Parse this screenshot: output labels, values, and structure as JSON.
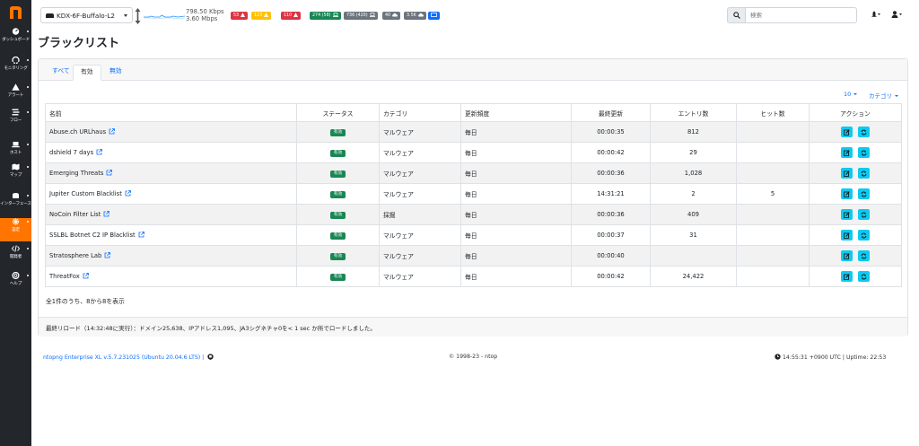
{
  "sidebar": {
    "items": [
      {
        "label": "ダッシュボード",
        "icon": "gauge-icon"
      },
      {
        "label": "モニタリング",
        "icon": "monitoring-icon"
      },
      {
        "label": "アラート",
        "icon": "warning-icon"
      },
      {
        "label": "フロー",
        "icon": "stream-icon"
      },
      {
        "label": "ホスト",
        "icon": "laptop-icon"
      },
      {
        "label": "マップ",
        "icon": "map-icon"
      },
      {
        "label": "インターフェース",
        "icon": "ethernet-icon"
      },
      {
        "label": "設定",
        "icon": "gear-icon"
      },
      {
        "label": "開発者",
        "icon": "code-icon"
      },
      {
        "label": "ヘルプ",
        "icon": "lifebuoy-icon"
      }
    ],
    "active_index": 7
  },
  "header": {
    "interface": "KDX-6F-Buffalo-L2",
    "speed_up": "798.50 Kbps",
    "speed_down": "3.60 Mbps",
    "badges": [
      {
        "text": "53",
        "color": "#dc3545"
      },
      {
        "text": "123",
        "color": "#ffc107"
      },
      {
        "text": "110",
        "color": "#dc3545"
      },
      {
        "text": "274 (58)",
        "color": "#198754"
      },
      {
        "text": "736 (420)",
        "color": "#6c757d"
      },
      {
        "text": "40",
        "color": "#6c757d"
      },
      {
        "text": "3.5K",
        "color": "#6c757d"
      },
      {
        "text": "",
        "color": "#0d6efd"
      }
    ],
    "search_placeholder": "検索"
  },
  "page": {
    "title": "ブラックリスト",
    "tabs": [
      "すべて",
      "有効",
      "無効"
    ],
    "active_tab": 1,
    "per_page": "10",
    "category_filter": "カテゴリ"
  },
  "table": {
    "columns": [
      "名前",
      "ステータス",
      "カテゴリ",
      "更新頻度",
      "最終更新",
      "エントリ数",
      "ヒット数",
      "アクション"
    ],
    "rows": [
      {
        "name": "Abuse.ch URLhaus",
        "status": "有効",
        "category": "マルウェア",
        "frequency": "毎日",
        "last_update": "00:00:35",
        "entries": "812",
        "hits": ""
      },
      {
        "name": "dshield 7 days",
        "status": "有効",
        "category": "マルウェア",
        "frequency": "毎日",
        "last_update": "00:00:42",
        "entries": "29",
        "hits": ""
      },
      {
        "name": "Emerging Threats",
        "status": "有効",
        "category": "マルウェア",
        "frequency": "毎日",
        "last_update": "00:00:36",
        "entries": "1,028",
        "hits": ""
      },
      {
        "name": "Jupiter Custom Blacklist",
        "status": "有効",
        "category": "マルウェア",
        "frequency": "毎日",
        "last_update": "14:31:21",
        "entries": "2",
        "hits": "5"
      },
      {
        "name": "NoCoin Filter List",
        "status": "有効",
        "category": "採掘",
        "frequency": "毎日",
        "last_update": "00:00:36",
        "entries": "409",
        "hits": ""
      },
      {
        "name": "SSLBL Botnet C2 IP Blacklist",
        "status": "有効",
        "category": "マルウェア",
        "frequency": "毎日",
        "last_update": "00:00:37",
        "entries": "31",
        "hits": ""
      },
      {
        "name": "Stratosphere Lab",
        "status": "有効",
        "category": "マルウェア",
        "frequency": "毎日",
        "last_update": "00:00:40",
        "entries": "",
        "hits": ""
      },
      {
        "name": "ThreatFox",
        "status": "有効",
        "category": "マルウェア",
        "frequency": "毎日",
        "last_update": "00:00:42",
        "entries": "24,422",
        "hits": ""
      }
    ],
    "summary": "全1件のうち、8から8を表示"
  },
  "card_footer": "最終リロード（14:32:48に実行）：ドメイン25,638、IPアドレス1,095、JA3シグネチャ0を< 1 sec か所でロードしました。",
  "footer": {
    "version": "ntopng Enterprise XL v.5.7.231025 (Ubuntu 20.04.6 LTS) |",
    "copyright": "© 1998-23 - ntop",
    "status": "14:55:31 +0900 UTC | Uptime: 22:53"
  },
  "colors": {
    "sidebar_bg": "#23272b",
    "active_orange": "#ff7500",
    "link_blue": "#0d6efd",
    "status_green": "#198754",
    "action_cyan": "#0dcaf0"
  }
}
